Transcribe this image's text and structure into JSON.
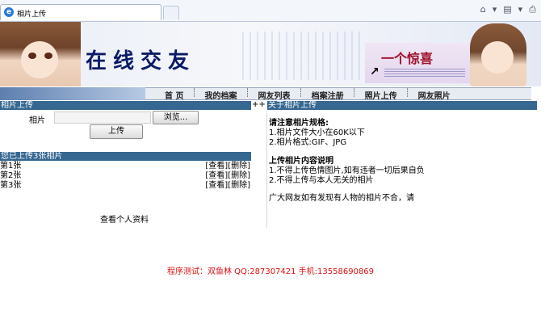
{
  "browser": {
    "tab_title": "相片上传"
  },
  "banner": {
    "site_title": "在线交友",
    "promo_text": "一个惊喜"
  },
  "nav": {
    "items": [
      "首 页",
      "我的档案",
      "网友列表",
      "档案注册",
      "照片上传",
      "网友照片"
    ]
  },
  "upload": {
    "section_title": "相片上传",
    "photo_label": "相片",
    "browse_label": "浏览...",
    "upload_button": "上传",
    "plus_marker": "++"
  },
  "uploaded": {
    "section_title": "您已上传3张相片",
    "photos": [
      {
        "name": "第1张",
        "actions": "[查看][删除]"
      },
      {
        "name": "第2张",
        "actions": "[查看][删除]"
      },
      {
        "name": "第3张",
        "actions": "[查看][删除]"
      }
    ],
    "view_profile": "查看个人资料"
  },
  "about": {
    "section_title": "关于相片上传",
    "spec_heading": "请注意相片规格:",
    "spec_1": "1.相片文件大小在60K以下",
    "spec_2": "2.相片格式:GIF、JPG",
    "content_heading": "上传相片内容说明",
    "content_1": "1.不得上传色情图片,如有违者一切后果自负",
    "content_2": "2.不得上传与本人无关的相片",
    "note": "广大网友如有发现有人物的相片不合，请"
  },
  "footer": {
    "text": "程序测试：双鱼林  QQ:287307421  手机:13558690869"
  },
  "colors": {
    "section_bar": "#366791",
    "footer_text": "#dd1111",
    "banner_title": "#0a1a66"
  }
}
